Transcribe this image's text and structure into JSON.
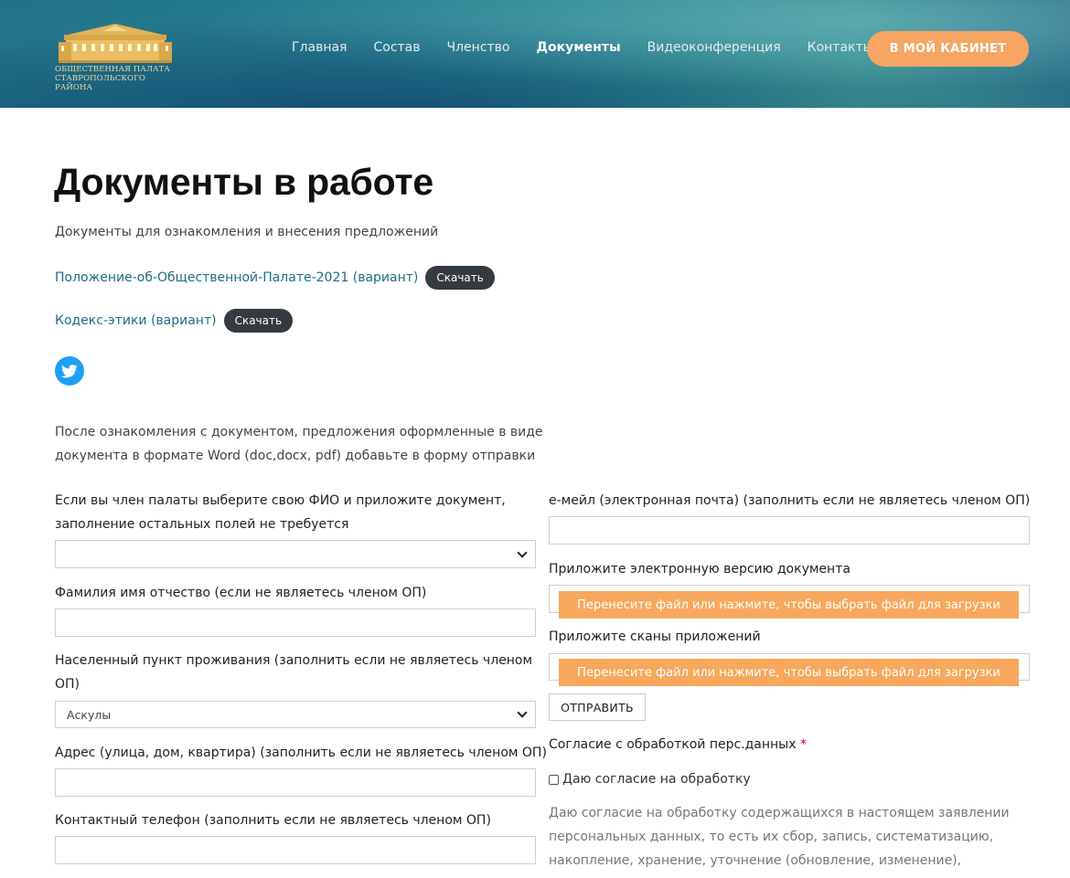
{
  "header": {
    "logo_line1": "ОБЩЕСТВЕННАЯ ПАЛАТА",
    "logo_line2": "СТАВРОПОЛЬСКОГО РАЙОНА",
    "nav": [
      "Главная",
      "Состав",
      "Членство",
      "Документы",
      "Видеоконференция",
      "Контакты"
    ],
    "active_nav": "Документы",
    "cabinet_button": "В МОЙ КАБИНЕТ",
    "accent_color": "#f6a563"
  },
  "main": {
    "title": "Документы в работе",
    "subtitle": "Документы для ознакомления и внесения предложений",
    "documents": [
      {
        "link": "Положение-об-Общественной-Палате-2021 (вариант)",
        "button": "Скачать"
      },
      {
        "link": "Кодекс-этики (вариант)",
        "button": "Скачать"
      }
    ],
    "share_icon": "twitter-icon",
    "note": "После ознакомления с документом, предложения оформленные в виде документа в формате Word (doc,docx, pdf) добавьте в форму отправки"
  },
  "form": {
    "member_label": "Если вы член палаты выберите свою ФИО и приложите документ, заполнение остальных полей не требуется",
    "member_value": "",
    "fio_label": "Фамилия имя отчество (если не являетесь членом ОП)",
    "fio_value": "",
    "locality_label": "Населенный пункт проживания (заполнить если не являетесь членом ОП)",
    "locality_value": "Аскулы",
    "address_label": "Адрес (улица, дом, квартира) (заполнить если не являетесь членом ОП)",
    "address_value": "",
    "phone_label": "Контактный телефон (заполнить если не являетесь членом ОП)",
    "phone_value": "",
    "email_label": "е-мейл (электронная почта) (заполнить если не являетесь членом ОП)",
    "email_value": "",
    "doc_upload_label": "Приложите электронную версию документа",
    "doc_upload_button": "Перенесите файл или нажмите, чтобы выбрать файл для загрузки",
    "scans_upload_label": "Приложите сканы приложений",
    "scans_upload_button": "Перенесите файл или нажмите, чтобы выбрать файл для загрузки",
    "submit": "ОТПРАВИТЬ",
    "consent_label": "Согласие с обработкой перс.данных",
    "required_mark": "*",
    "consent_checkbox": "Даю согласие на обработку",
    "consent_text": "Даю согласие на обработку содержащихся в настоящем заявлении персональных данных, то есть их сбор, запись, систематизацию, накопление, хранение, уточнение (обновление, изменение), извлечение,"
  }
}
